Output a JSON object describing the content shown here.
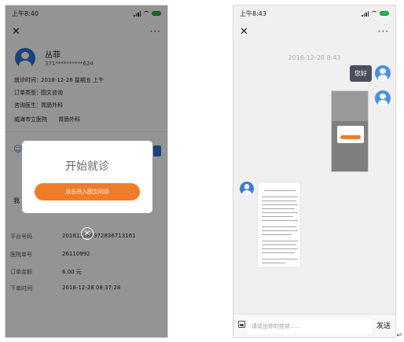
{
  "left": {
    "status": {
      "time": "上午8:40"
    },
    "nav": {
      "close": "✕",
      "more": "···"
    },
    "patient": {
      "name": "丛菲",
      "phone": "371**********624"
    },
    "info": {
      "visit_time_label": "就诊时间：",
      "visit_time": "2018-12-28 星期五 上午",
      "order_type_label": "订单类型：",
      "order_type": "图文咨询",
      "doctor_label": "咨询医生：",
      "doctor": "胃肠外科",
      "hospital": "威海市立医院",
      "department": "胃肠外科"
    },
    "partial_text": "我",
    "modal": {
      "title": "开始就诊",
      "button": "点击进入图文问诊"
    },
    "details": [
      {
        "label": "平台号码",
        "value": "20181228837283671316​1"
      },
      {
        "label": "医院单号",
        "value": "26110992"
      },
      {
        "label": "订单金额",
        "value": "6.00 元"
      },
      {
        "label": "下单时间",
        "value": "2018-12-28 08:37:28"
      }
    ]
  },
  "right": {
    "status": {
      "time": "上午8:43"
    },
    "nav": {
      "close": "✕",
      "more": "···"
    },
    "timestamp": "2018-12-28   8:43",
    "greeting": "您好",
    "input_placeholder": "请说出你的症状......",
    "send": "发送"
  },
  "return_mark": "↵",
  "colors": {
    "accent_orange": "#f07c2a",
    "avatar_blue": "#2e73d6",
    "bubble_dark": "#4a4f5e"
  }
}
